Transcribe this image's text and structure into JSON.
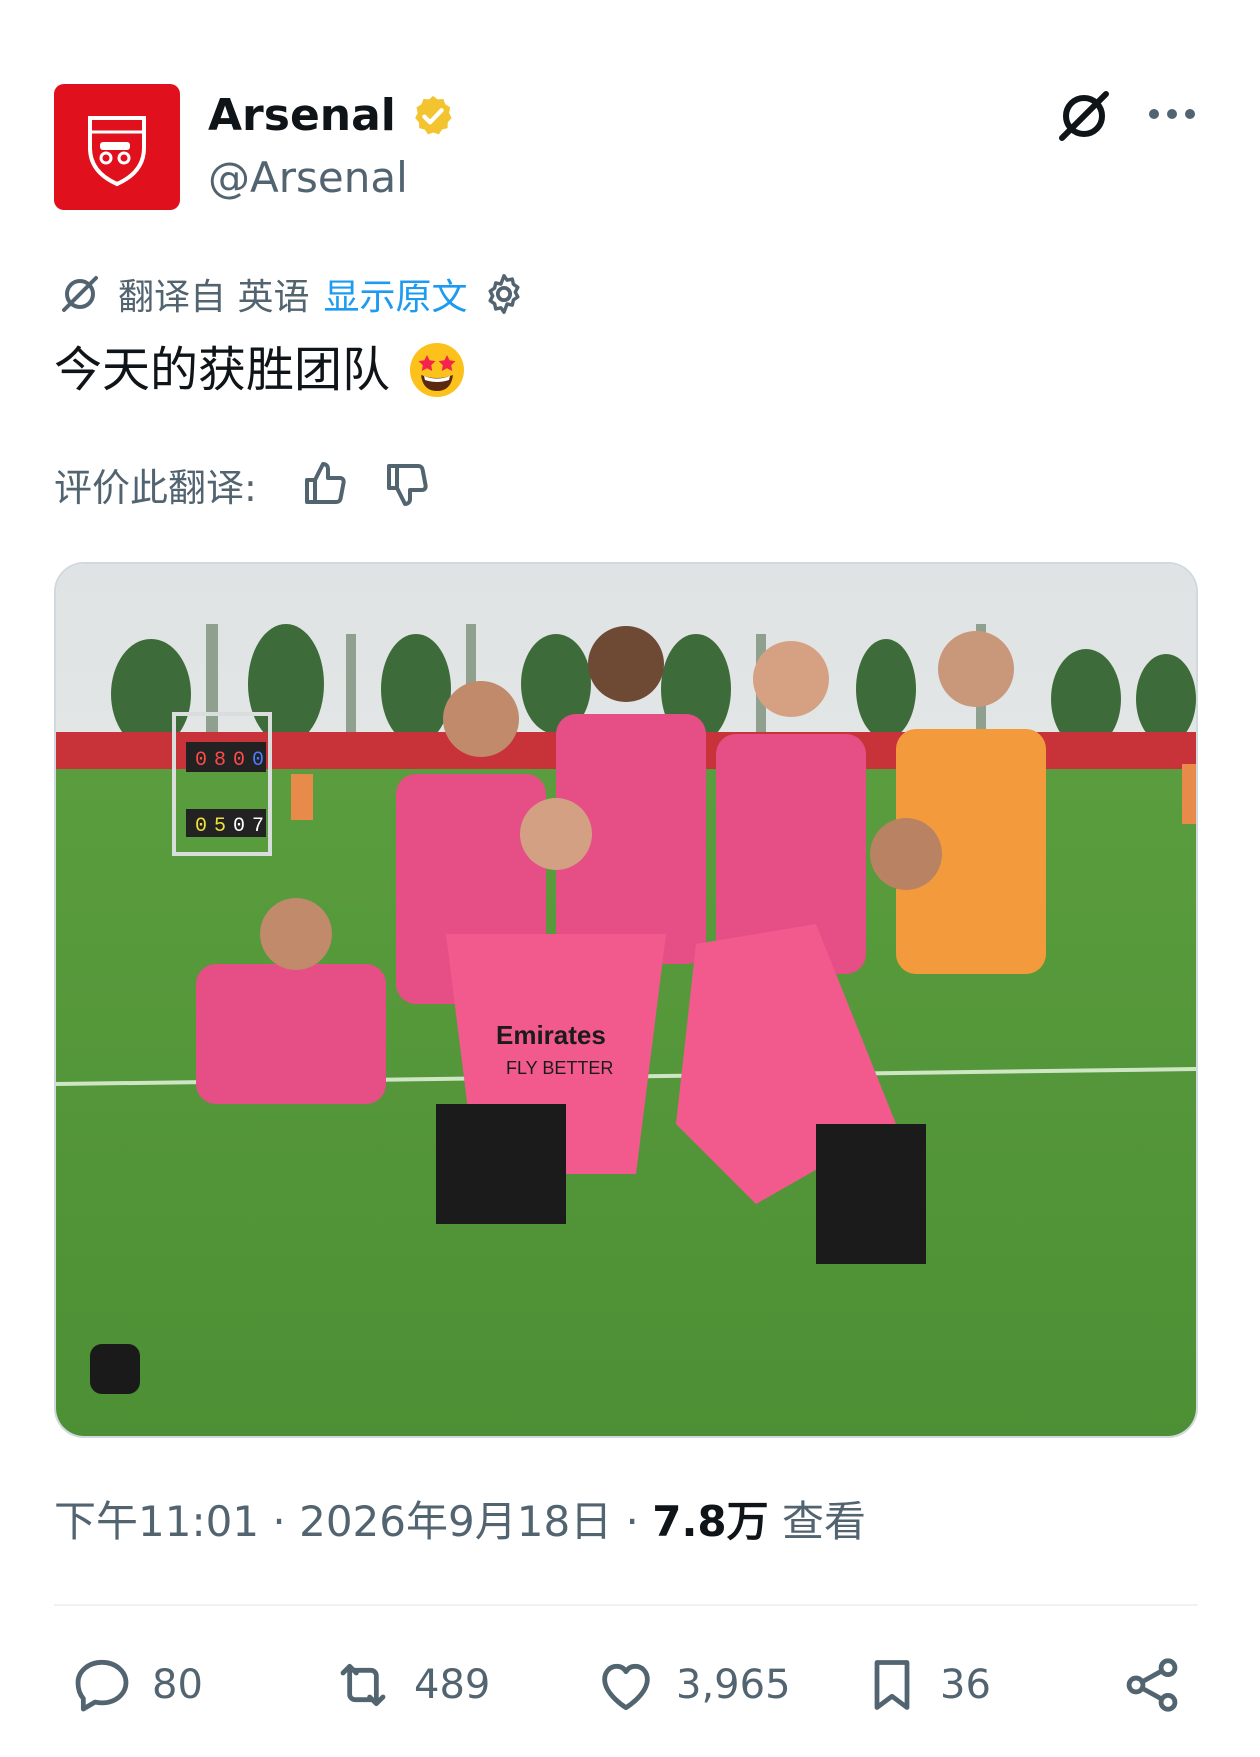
{
  "account": {
    "display_name": "Arsenal",
    "handle": "@Arsenal",
    "verified_badge_color": "#f4c430",
    "avatar_color": "#e0101c",
    "avatar_text": "Arsenal"
  },
  "translation": {
    "translated_from": "翻译自 英语",
    "show_original": "显示原文"
  },
  "tweet": {
    "text": "今天的获胜团队",
    "emoji": "🤩"
  },
  "rate_translation": {
    "label": "评价此翻译:"
  },
  "media": {
    "scoreboard_top": [
      "0",
      "8",
      "0",
      "0"
    ],
    "scoreboard_bottom": [
      "0",
      "5",
      "0",
      "7"
    ],
    "bib_text_1": "Emirates",
    "bib_text_2": "FLY BETTER"
  },
  "meta": {
    "time": "下午11:01",
    "separator": " · ",
    "date": "2026年9月18日",
    "views_count": "7.8万",
    "views_label": "查看"
  },
  "actions": {
    "replies": "80",
    "reposts": "489",
    "likes": "3,965",
    "bookmarks": "36"
  },
  "colors": {
    "link": "#1d9bf0",
    "secondary_text": "#536471",
    "primary_text": "#0f1419"
  }
}
